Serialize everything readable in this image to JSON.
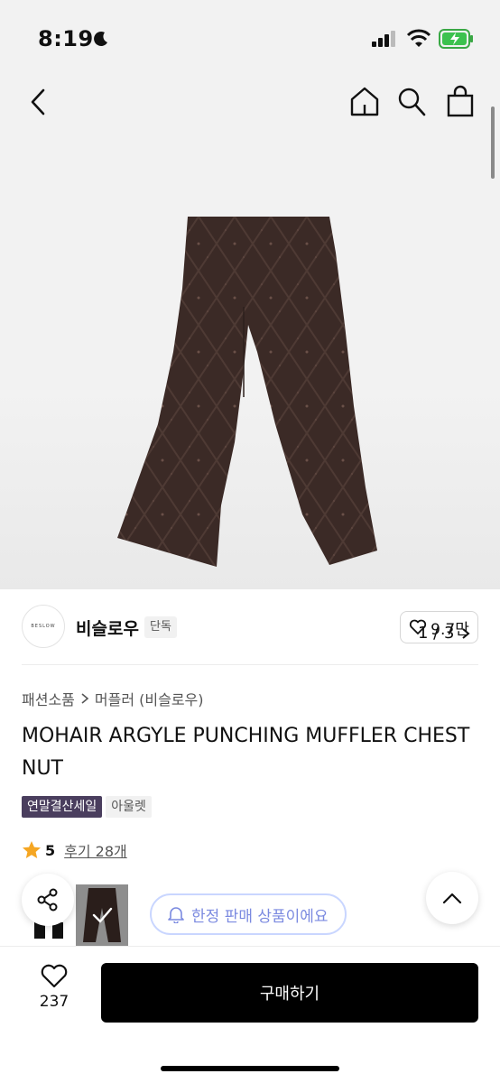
{
  "status_bar": {
    "time": "8:19"
  },
  "nav": {
    "back_icon": "chevron-left-icon",
    "home_icon": "home-icon",
    "search_icon": "search-icon",
    "bag_icon": "shopping-bag-icon"
  },
  "gallery": {
    "page_indicator": "1 / 3"
  },
  "brand": {
    "logo_text": "BESLOW",
    "name": "비슬로우",
    "badge": "단독",
    "like_count": "9.7만"
  },
  "breadcrumb": {
    "category": "패션소품",
    "subcategory": "머플러 (비슬로우)"
  },
  "product": {
    "title": "MOHAIR ARGYLE PUNCHING MUFFLER CHESTNUT"
  },
  "tags": {
    "sale": "연말결산세일",
    "outlet": "아울렛"
  },
  "rating": {
    "score": "5",
    "reviews": "후기 28개"
  },
  "limited": {
    "text": "한정 판매 상품이에요"
  },
  "bottom": {
    "wish_count": "237",
    "buy_label": "구매하기"
  },
  "colors": {
    "sale_tag": "#4a3e5e",
    "limited_text": "#7b8ae0",
    "star": "#f5a623"
  }
}
